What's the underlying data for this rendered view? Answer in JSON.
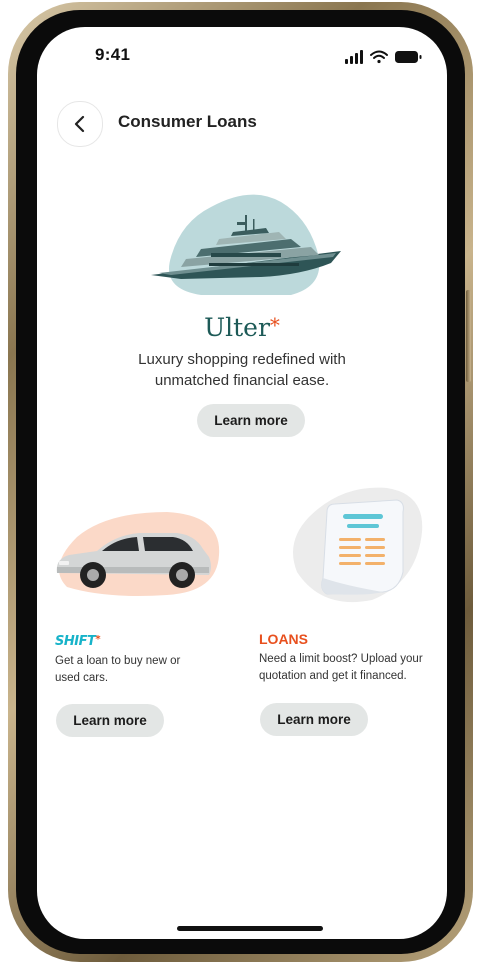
{
  "status_bar": {
    "time": "9:41"
  },
  "header": {
    "title": "Consumer Loans",
    "back_icon": "chevron-left-icon"
  },
  "hero": {
    "brand_name": "Ulter",
    "brand_mark": "*",
    "description": "Luxury shopping redefined with unmatched financial ease.",
    "button_label": "Learn more",
    "illustration": "yacht-illustration",
    "blob_color": "#bcd9db"
  },
  "cards": [
    {
      "brand_name": "SHIFT",
      "brand_mark": "*",
      "brand_color": "#17b3c9",
      "description": "Get a loan to buy new or used cars.",
      "button_label": "Learn more",
      "illustration": "car-illustration",
      "blob_color": "#fbd9c8"
    },
    {
      "brand_name": "LOANS",
      "brand_color": "#e8501e",
      "description": "Need a limit boost? Upload your quotation and get it financed.",
      "button_label": "Learn more",
      "illustration": "receipt-illustration",
      "blob_color": "#ececec"
    }
  ],
  "theme": {
    "accent": "#e8501e",
    "button_bg": "#e3e6e5",
    "ulter_green": "#1d5a57"
  }
}
